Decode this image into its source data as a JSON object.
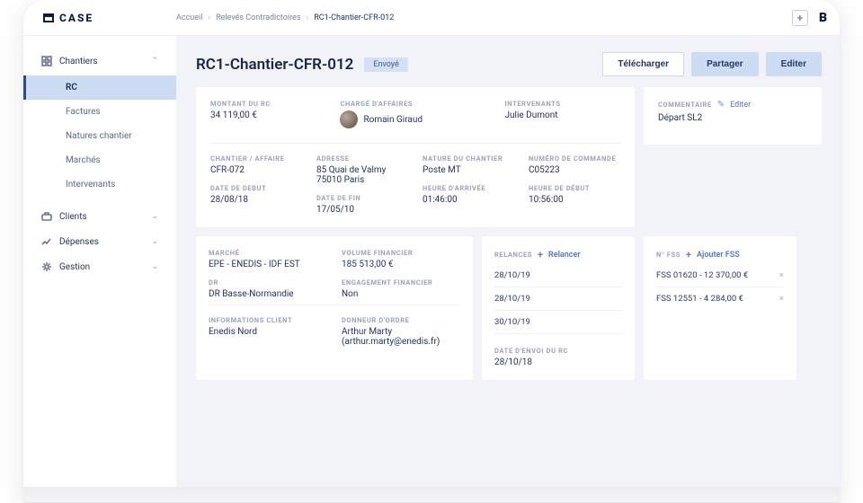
{
  "logo_text": "CASE",
  "breadcrumb": {
    "root": "Accueil",
    "mid": "Relevés Contradictoires",
    "current": "RC1-Chantier-CFR-012"
  },
  "sidebar": {
    "parent_chantiers": "Chantiers",
    "children": {
      "rc": "RC",
      "factures": "Factures",
      "natures": "Natures chantier",
      "marches": "Marchés",
      "intervenants": "Intervenants"
    },
    "clients": "Clients",
    "depenses": "Dépenses",
    "gestion": "Gestion"
  },
  "header": {
    "title": "RC1-Chantier-CFR-012",
    "status": "Envoyé",
    "download": "Télécharger",
    "share": "Partager",
    "edit": "Editer"
  },
  "summary": {
    "montant_label": "MONTANT DU RC",
    "montant_value": "34 119,00 €",
    "charge_label": "CHARGÉ D'AFFAIRES",
    "charge_value": "Romain Giraud",
    "intervenants_label": "INTERVENANTS",
    "intervenants_value": "Julie Dumont"
  },
  "comment": {
    "label": "COMMENTAIRE",
    "edit": "Editer",
    "value": "Départ SL2"
  },
  "details": {
    "chantier_label": "CHANTIER / AFFAIRE",
    "chantier_value": "CFR-072",
    "adresse_label": "ADRESSE",
    "adresse_value": "85 Quai de Valmy\n75010 Paris",
    "nature_label": "NATURE DU CHANTIER",
    "nature_value": "Poste MT",
    "commande_label": "NUMÉRO DE COMMANDE",
    "commande_value": "C05223",
    "date_debut_label": "DATE DE DEBUT",
    "date_debut_value": "28/08/18",
    "date_fin_label": "DATE DE FIN",
    "date_fin_value": "17/05/10",
    "heure_arrivee_label": "HEURE D'ARRIVÉE",
    "heure_arrivee_value": "01:46:00",
    "heure_debut_label": "HEURE DE DÉBUT",
    "heure_debut_value": "10:56:00"
  },
  "market": {
    "marche_label": "MARCHÉ",
    "marche_value": "EPE - ENEDIS - IDF EST",
    "volume_label": "VOLUME FINANCIER",
    "volume_value": "185 513,00 €",
    "dr_label": "DR",
    "dr_value": "DR Basse-Normandie",
    "engagement_label": "ENGAGEMENT FINANCIER",
    "engagement_value": "Non",
    "info_client_label": "INFORMATIONS CLIENT",
    "info_client_value": "Enedis Nord",
    "donneur_label": "DONNEUR D'ORDRE",
    "donneur_value": "Arthur Marty\n(arthur.marty@enedis.fr)"
  },
  "relances": {
    "label": "RELANCES",
    "action": "Relancer",
    "items": [
      "28/10/19",
      "28/10/19",
      "30/10/19"
    ],
    "envoi_label": "DATE D'ENVOI DU RC",
    "envoi_value": "28/10/18"
  },
  "fss": {
    "label": "N° FSS",
    "action": "Ajouter FSS",
    "items": [
      "FSS 01620 - 12 370,00 €",
      "FSS 12551 - 4 284,00 €"
    ]
  }
}
